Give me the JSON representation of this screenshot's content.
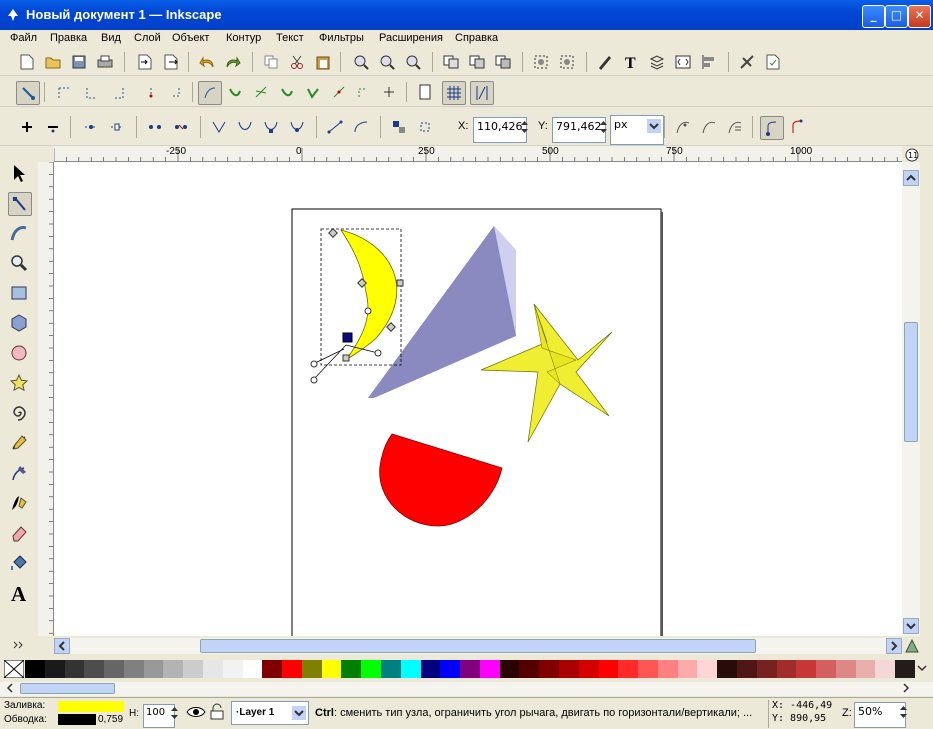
{
  "window": {
    "title": "Новый документ 1 — Inkscape"
  },
  "menu": [
    "Файл",
    "Правка",
    "Вид",
    "Слой",
    "Объект",
    "Контур",
    "Текст",
    "Фильтры",
    "Расширения",
    "Справка"
  ],
  "toolcontrols": {
    "x_label": "X:",
    "x_value": "110,426",
    "y_label": "Y:",
    "y_value": "791,462",
    "unit": "px"
  },
  "ruler_h": [
    "-250",
    "0",
    "250",
    "500",
    "750",
    "1000"
  ],
  "ruler_v": [
    "0",
    "0",
    "5",
    "2",
    "5",
    "0",
    "7",
    "5",
    "0",
    "1",
    "0",
    "0",
    "0",
    "1",
    "2",
    "5",
    "0"
  ],
  "status": {
    "fill_label": "Заливка:",
    "stroke_label": "Обводка:",
    "stroke_width": "0,759",
    "h_label": "H:",
    "h_value": "100",
    "layer": "·Layer 1",
    "message_bold": "Ctrl",
    "message": ": сменить тип узла, ограничить угол рычага, двигать по горизонтали/вертикали; ...",
    "coord_x": "X: -446,49",
    "coord_y": "Y:  890,95",
    "zoom_label": "Z:",
    "zoom": "50%"
  },
  "tools": [
    "selector-tool",
    "node-tool",
    "tweak-tool",
    "zoom-tool",
    "rect-tool",
    "box3d-tool",
    "ellipse-tool",
    "star-tool",
    "spiral-tool",
    "pencil-tool",
    "pen-tool",
    "calligraphy-tool",
    "eraser-tool",
    "bucket-tool",
    "text-tool"
  ],
  "colors": {
    "fill": "#ffff00",
    "stroke": "#000000",
    "palette": [
      "#000000",
      "#1a1a1a",
      "#333333",
      "#4d4d4d",
      "#666666",
      "#808080",
      "#999999",
      "#b3b3b3",
      "#cccccc",
      "#e6e6e6",
      "#f2f2f2",
      "#ffffff",
      "#800000",
      "#ff0000",
      "#808000",
      "#ffff00",
      "#008000",
      "#00ff00",
      "#008080",
      "#00ffff",
      "#000080",
      "#0000ff",
      "#800080",
      "#ff00ff",
      "#2b0000",
      "#550000",
      "#800000",
      "#aa0000",
      "#d40000",
      "#ff0000",
      "#ff2a2a",
      "#ff5555",
      "#ff8080",
      "#ffaaaa",
      "#ffd5d5",
      "#280b0b",
      "#501616",
      "#782121",
      "#a02c2c",
      "#c83737",
      "#d35f5f",
      "#de8787",
      "#e9afaf",
      "#f4d7d7",
      "#241c1c"
    ]
  }
}
